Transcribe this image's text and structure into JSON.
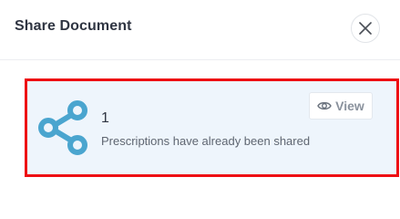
{
  "dialog": {
    "title": "Share Document",
    "close_icon": "close-icon"
  },
  "share_card": {
    "icon": "share-icon",
    "count": "1",
    "message": "Prescriptions have already been shared",
    "view_button": {
      "icon": "eye-icon",
      "label": "View"
    },
    "highlight_color": "#ee0e13",
    "background_color": "#eef5fc",
    "icon_color": "#4aa5cf"
  }
}
